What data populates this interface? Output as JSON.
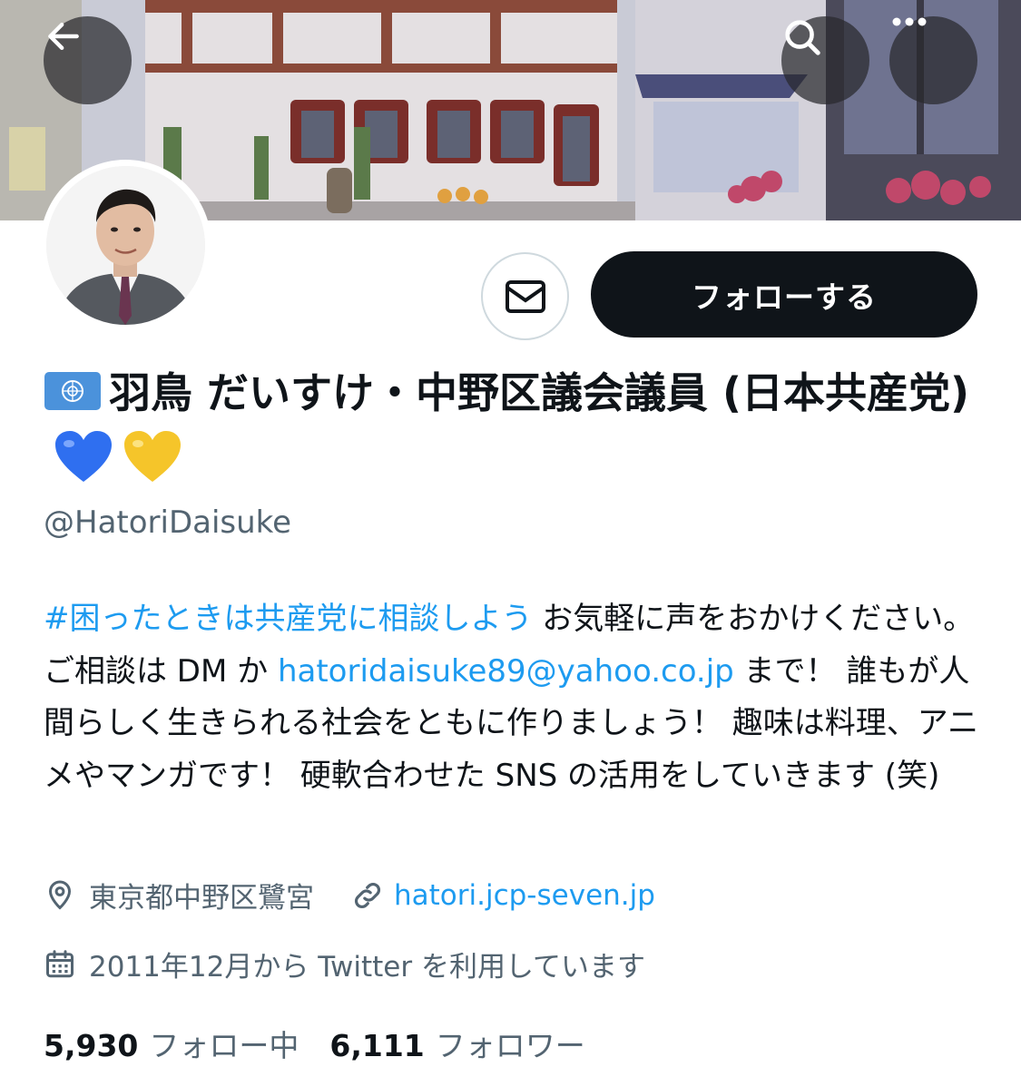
{
  "header": {
    "back_icon": "arrow-left-icon",
    "search_icon": "search-icon",
    "more_icon": "more-dots-icon"
  },
  "profile": {
    "name_prefix_emoji": "🇺🇳",
    "name": "羽鳥 だいすけ・中野区議会議員 (日本共産党)",
    "name_suffix_emoji": "💙💛",
    "handle": "@HatoriDaisuke",
    "follow_label": "フォローする",
    "dm_icon": "envelope-icon"
  },
  "bio": {
    "hashtag": "#困ったときは共産党に相談しよう",
    "text_1": " お気軽に声をおかけください。ご相談は DM か ",
    "email": "hatoridaisuke89@yahoo.co.jp",
    "text_2": " まで！ 誰もが人間らしく生きられる社会をともに作りましょう！ 趣味は料理、アニメやマンガです！ 硬軟合わせた SNS の活用をしていきます (笑)"
  },
  "meta": {
    "location": "東京都中野区鷺宮",
    "website": "hatori.jcp-seven.jp",
    "joined": "2011年12月から Twitter を利用しています"
  },
  "stats": {
    "following_count": "5,930",
    "following_label": "フォロー中",
    "followers_count": "6,111",
    "followers_label": "フォロワー"
  },
  "colors": {
    "link": "#1d9bf0",
    "text": "#0f1419",
    "secondary": "#536471",
    "follow_bg": "#0f1419"
  }
}
